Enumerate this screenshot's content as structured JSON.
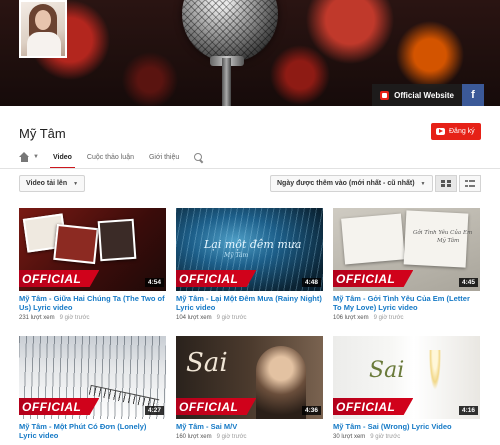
{
  "banner": {
    "official_website": "Official Website",
    "facebook": "f"
  },
  "channel": {
    "name": "Mỹ Tâm",
    "subscribe": "Đăng ký"
  },
  "tabs": [
    "Video",
    "Cuộc thảo luận",
    "Giới thiệu"
  ],
  "controls": {
    "filter": "Video tải lên",
    "sort": "Ngày được thêm vào (mới nhất - cũ nhất)"
  },
  "badge": "OFFICIAL",
  "videos": [
    {
      "title": "Mỹ Tâm - Giữa Hai Chúng Ta (The Two of Us) Lyric video",
      "duration": "4:54",
      "views": "231 lượt xem",
      "ago": "9 giờ trước"
    },
    {
      "title": "Mỹ Tâm - Lại Một Đêm Mưa (Rainy Night) Lyric video",
      "duration": "4:48",
      "views": "104 lượt xem",
      "ago": "9 giờ trước",
      "caption": "Lại một đêm mưa",
      "caption2": "Mỹ Tâm"
    },
    {
      "title": "Mỹ Tâm - Gởi Tình Yêu Của Em (Letter To My Love) Lyric video",
      "duration": "4:45",
      "views": "106 lượt xem",
      "ago": "9 giờ trước",
      "caption": "Gởi Tình Yêu Của Em",
      "caption2": "Mỹ Tâm"
    },
    {
      "title": "Mỹ Tâm - Một Phút Có Đơn (Lonely) Lyric video",
      "duration": "4:27",
      "views": "",
      "ago": ""
    },
    {
      "title": "Mỹ Tâm - Sai M/V",
      "duration": "4:36",
      "views": "160 lượt xem",
      "ago": "9 giờ trước",
      "caption": "Sai"
    },
    {
      "title": "Mỹ Tâm - Sai (Wrong) Lyric Video",
      "duration": "4:16",
      "views": "30 lượt xem",
      "ago": "9 giờ trước",
      "caption": "Sai"
    }
  ]
}
